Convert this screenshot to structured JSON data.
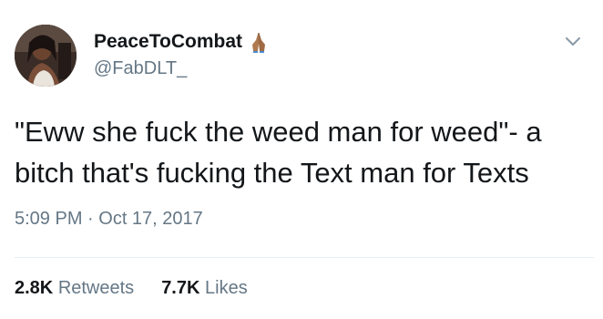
{
  "tweet": {
    "display_name": "PeaceToCombat",
    "handle": "@FabDLT_",
    "text": "\"Eww she fuck the weed man for weed\"- a\nbitch that's fucking the Text man for Texts",
    "timestamp": "5:09 PM · Oct 17, 2017",
    "retweets_count": "2.8K",
    "retweets_label": "Retweets",
    "likes_count": "7.7K",
    "likes_label": "Likes"
  },
  "icons": {
    "name_emoji": "folded-hands-icon",
    "menu": "chevron-down-icon",
    "avatar": "avatar"
  },
  "colors": {
    "text_primary": "#14171a",
    "text_secondary": "#657786",
    "divider": "#e6ecf0",
    "background": "#ffffff"
  }
}
